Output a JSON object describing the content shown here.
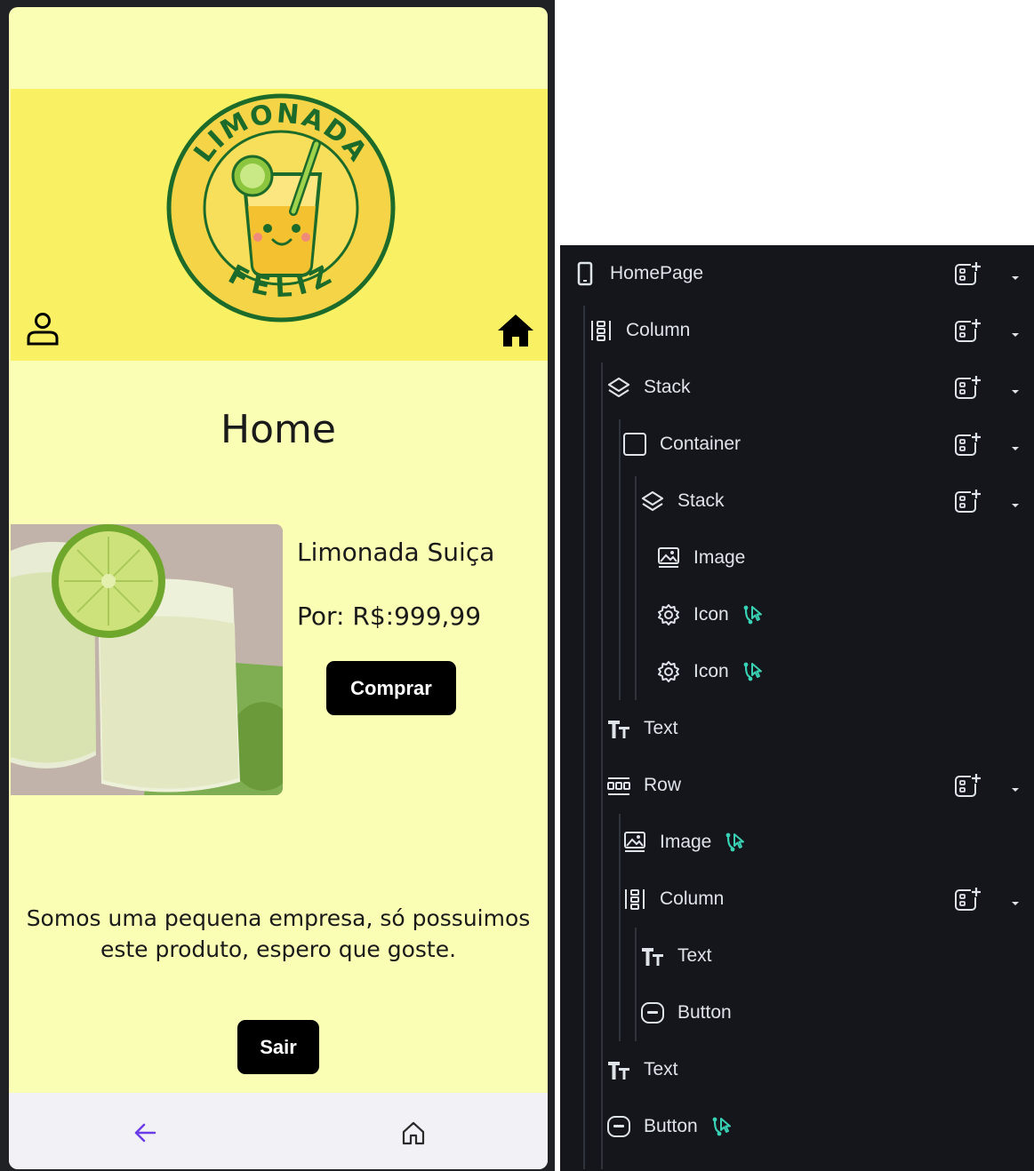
{
  "app": {
    "header": {
      "logo": {
        "top_text": "LIMONADA",
        "bottom_text": "FELIZ"
      }
    },
    "page_title": "Home",
    "product": {
      "name": "Limonada Suiça",
      "price": "Por: R$:999,99",
      "buy_label": "Comprar"
    },
    "about_text": "Somos uma pequena empresa, só possuimos este produto, espero que goste.",
    "exit_label": "Sair",
    "nav": {
      "back_icon": "arrow-left-icon",
      "home_icon": "home-outline-icon"
    },
    "colors": {
      "page_background": "#fafdb4",
      "header_background": "#f9f163",
      "button_background": "#000000",
      "nav_background": "#f2f1f6",
      "nav_back_color": "#6a3de8"
    }
  },
  "widget_tree": {
    "colors": {
      "panel_background": "#14161b",
      "action_icon": "#39d2b4",
      "text": "#dfe3ea"
    },
    "nodes": [
      {
        "label": "HomePage",
        "icon": "phone-icon",
        "has_add": true
      },
      {
        "label": "Column",
        "icon": "column-icon",
        "has_add": true
      },
      {
        "label": "Stack",
        "icon": "stack-icon",
        "has_add": true
      },
      {
        "label": "Container",
        "icon": "container-icon",
        "has_add": true
      },
      {
        "label": "Stack",
        "icon": "stack-icon",
        "has_add": true
      },
      {
        "label": "Image",
        "icon": "image-icon",
        "has_add": false
      },
      {
        "label": "Icon",
        "icon": "gear-icon",
        "has_add": false,
        "has_action": true
      },
      {
        "label": "Icon",
        "icon": "gear-icon",
        "has_add": false,
        "has_action": true
      },
      {
        "label": "Text",
        "icon": "text-icon",
        "has_add": false
      },
      {
        "label": "Row",
        "icon": "row-icon",
        "has_add": true
      },
      {
        "label": "Image",
        "icon": "image-icon",
        "has_add": false,
        "has_action": true
      },
      {
        "label": "Column",
        "icon": "column-icon",
        "has_add": true
      },
      {
        "label": "Text",
        "icon": "text-icon",
        "has_add": false
      },
      {
        "label": "Button",
        "icon": "button-icon",
        "has_add": false
      },
      {
        "label": "Text",
        "icon": "text-icon",
        "has_add": false
      },
      {
        "label": "Button",
        "icon": "button-icon",
        "has_add": false,
        "has_action": true
      }
    ]
  }
}
